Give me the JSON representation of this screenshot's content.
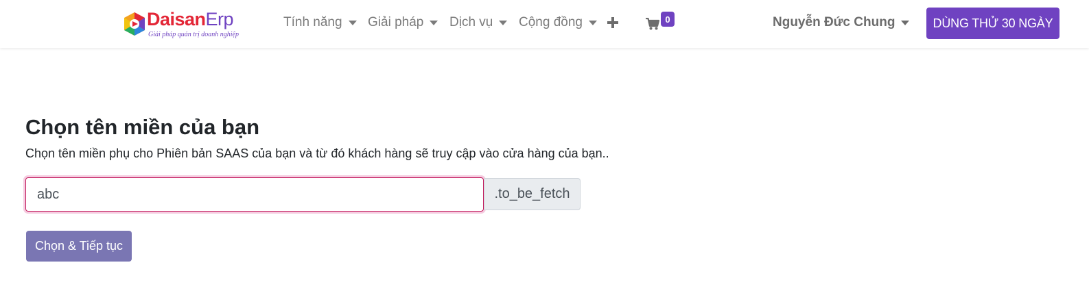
{
  "navbar": {
    "logo": {
      "word_part1": "Daisan",
      "word_part2": "Erp",
      "tagline": "Giải pháp quản trị doanh nghiệp"
    },
    "menu": [
      {
        "label": "Tính năng",
        "has_dropdown": true
      },
      {
        "label": "Giải pháp",
        "has_dropdown": true
      },
      {
        "label": "Dịch vụ",
        "has_dropdown": true
      },
      {
        "label": "Cộng đồng",
        "has_dropdown": true
      }
    ],
    "plus_icon": "plus-icon",
    "cart": {
      "icon": "cart-icon",
      "count": "0"
    },
    "user": {
      "name": "Nguyễn Đức Chung",
      "has_dropdown": true
    },
    "trial_button": "DÙNG THỬ 30 NGÀY"
  },
  "content": {
    "title": "Chọn tên miền của bạn",
    "subtitle": "Chọn tên miền phụ cho Phiên bản SAAS của bạn và từ đó khách hàng sẽ truy cập vào cửa hàng của bạn..",
    "domain_input": {
      "value": "abc"
    },
    "domain_suffix": ".to_be_fetch",
    "submit_button": "Chọn & Tiếp tục"
  },
  "colors": {
    "brand_purple": "#6f42c1",
    "button_muted": "#7a76b3",
    "input_border_focus": "#c2185b",
    "nav_text": "#7b7b7b"
  }
}
